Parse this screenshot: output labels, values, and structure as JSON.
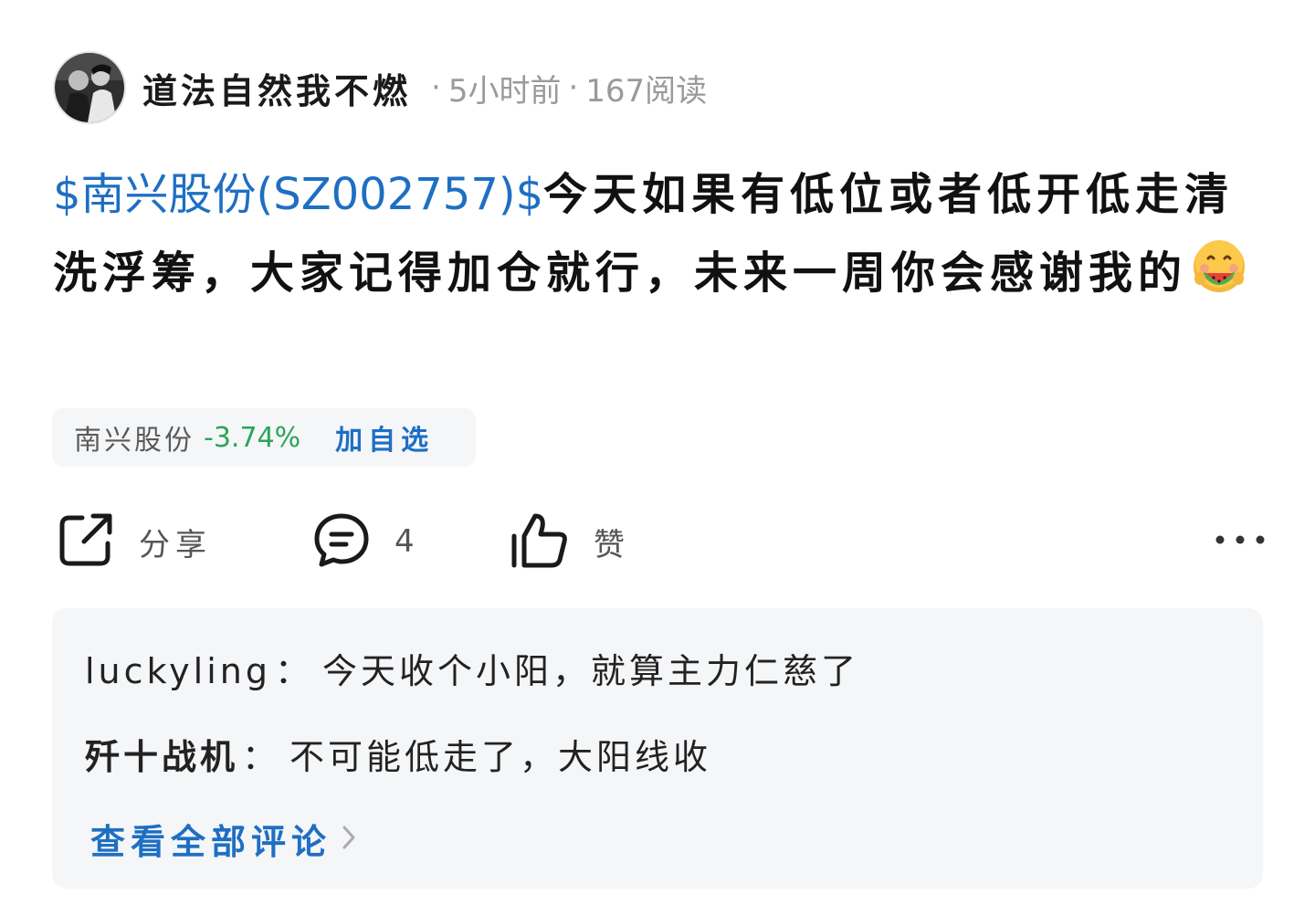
{
  "author": {
    "name": "道法自然我不燃",
    "time": "5小时前",
    "reads": "167阅读",
    "separator": "·"
  },
  "post": {
    "stock_tag": "$南兴股份(SZ002757)$",
    "text": "今天如果有低位或者低开低走清洗浮筹，大家记得加仓就行，未来一周你会感谢我的",
    "emoji_icon": "watermelon-face-emoji"
  },
  "stock_chip": {
    "name": "南兴股份",
    "change": "-3.74%",
    "add_label": "加自选"
  },
  "actions": {
    "share_label": "分享",
    "comment_count": "4",
    "like_label": "赞"
  },
  "comments": [
    {
      "user": "luckyling",
      "colon": "：",
      "text": "今天收个小阳，就算主力仁慈了"
    },
    {
      "user": "歼十战机",
      "colon": "：",
      "text": "不可能低走了，大阳线收"
    }
  ],
  "view_all_label": "查看全部评论",
  "colors": {
    "link_blue": "#1e6fc3",
    "down_green": "#2aa55a",
    "meta_gray": "#9a9a9a",
    "panel_bg": "#f5f6f8"
  }
}
